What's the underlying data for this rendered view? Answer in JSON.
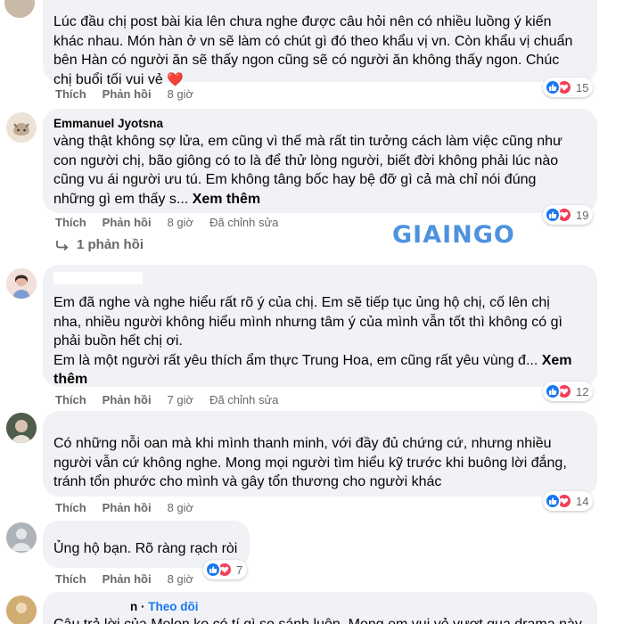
{
  "comments": [
    {
      "author": "",
      "text_lines": [
        "Lúc đầu chị post bài kia lên chưa nghe được câu hỏi nên có nhiều luồng ý kiến",
        "khác nhau. Món hàn ở vn sẽ làm có chút gì đó theo khẩu vị vn. Còn khẩu vị chuẩn",
        "bên Hàn có người ăn sẽ thấy ngon cũng sẽ có người ăn không thấy ngon. Chúc",
        "chị buổi tối vui vẻ"
      ],
      "emoji": "❤️",
      "like_label": "Thích",
      "reply_label": "Phản hồi",
      "time": "8 giờ",
      "reaction_count": "15"
    },
    {
      "author": "Emmanuel Jyotsna",
      "text_lines": [
        "vàng thật không sợ lửa, em cũng vì thế mà rất tin tưởng cách làm việc cũng như",
        "con người chị, bão giông có to là để thử lòng người, biết đời không phải lúc nào",
        "cũng vu ái người ưu tú. Em không tâng bốc hay bệ đỡ gì cả mà chỉ nói đúng",
        "những gì em thấy s..."
      ],
      "see_more": "Xem thêm",
      "like_label": "Thích",
      "reply_label": "Phản hồi",
      "time": "8 giờ",
      "edited": "Đã chỉnh sửa",
      "reaction_count": "19",
      "replies_label": "1 phản hồi"
    },
    {
      "author": "",
      "text_lines": [
        "Em đã nghe và nghe hiểu rất rõ ý của chị. Em sẽ tiếp tục ủng hộ chị, cố lên chị",
        "nha, nhiều người không hiểu mình nhưng tâm ý của mình vẫn tốt thì không có gì",
        "phải buồn hết chị ơi.",
        "Em là một người rất yêu thích ẩm thực Trung Hoa, em cũng rất yêu vùng đ..."
      ],
      "see_more_1": "Xem",
      "see_more_2": "thêm",
      "like_label": "Thích",
      "reply_label": "Phản hồi",
      "time": "7 giờ",
      "edited": "Đã chỉnh sửa",
      "reaction_count": "12"
    },
    {
      "author": "",
      "text_lines": [
        "Có những nỗi oan mà khi mình thanh minh, với đầy đủ chứng cứ, nhưng nhiều",
        "người vẫn cứ không nghe. Mong mọi người tìm hiểu kỹ trước khi buông lời đắng,",
        "tránh tổn phước cho mình và gây tổn thương cho người khác"
      ],
      "like_label": "Thích",
      "reply_label": "Phản hồi",
      "time": "8 giờ",
      "reaction_count": "14"
    },
    {
      "author": "",
      "text_lines": [
        "Ủng hộ bạn. Rõ ràng rạch ròi"
      ],
      "like_label": "Thích",
      "reply_label": "Phản hồi",
      "time": "8 giờ",
      "reaction_count": "7"
    },
    {
      "author_partial": "n",
      "follow_label": "Theo dõi",
      "text_lines": [
        "Câu trả lời của Melon ko có tí gì so sánh luôn. Mong em vui vẻ vượt qua drama này"
      ]
    }
  ],
  "watermark": "GIAINGO",
  "icons": {
    "like": "thumbs-up-icon",
    "love": "heart-icon",
    "reply_arrow": "reply-arrow-icon"
  },
  "colors": {
    "bubble": "#f0f2f5",
    "meta_text": "#65676b",
    "like_blue": "#1877f2",
    "love_red": "#f33e58",
    "watermark": "#2e7fd9"
  }
}
